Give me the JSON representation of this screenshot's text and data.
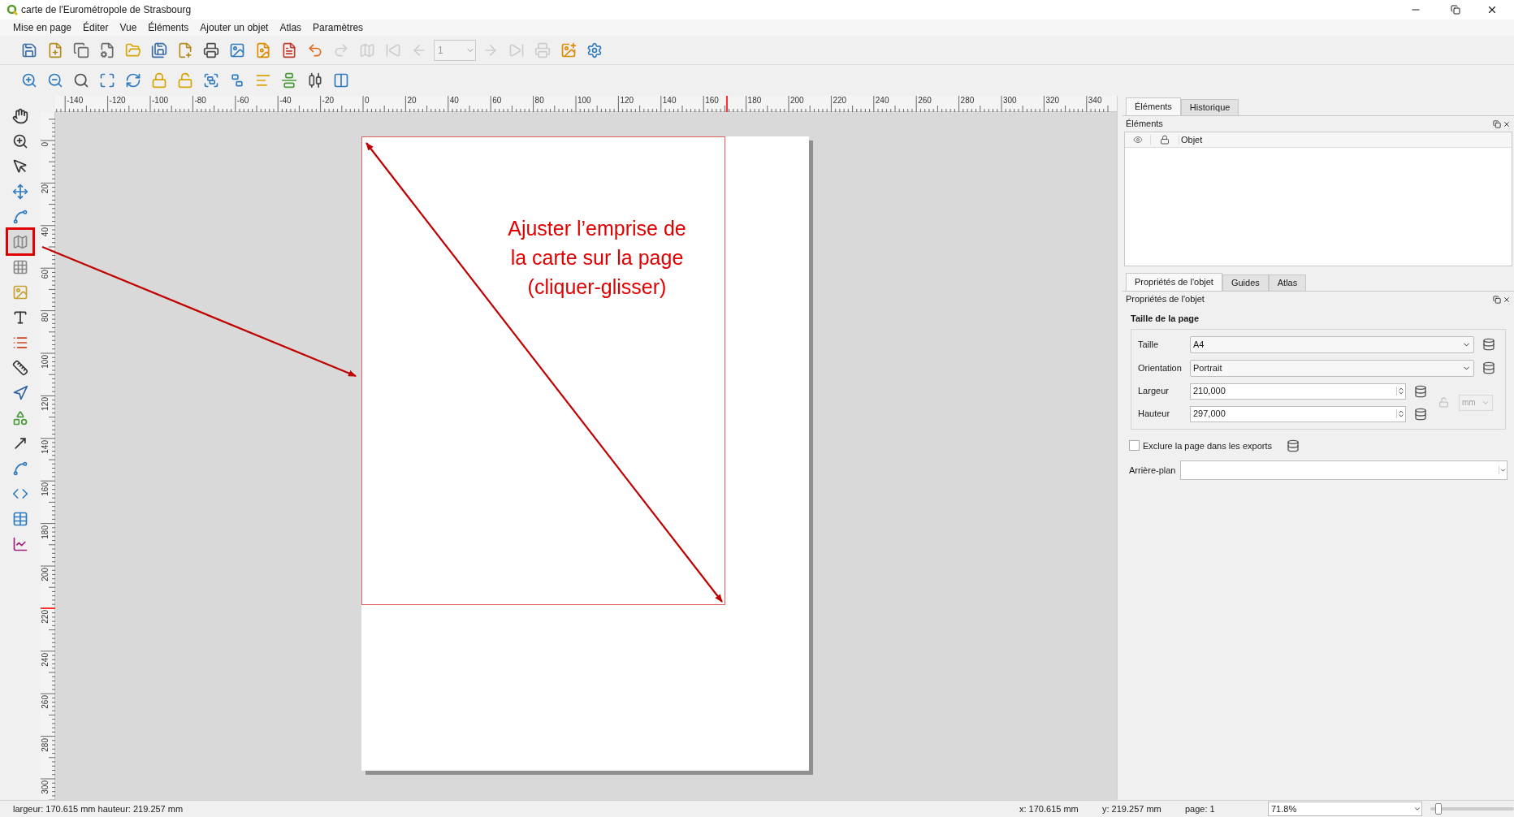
{
  "window": {
    "title": "carte de l'Eurométropole de Strasbourg"
  },
  "menu": [
    {
      "label": "Mise en page"
    },
    {
      "label": "Éditer"
    },
    {
      "label": "Vue"
    },
    {
      "label": "Éléments"
    },
    {
      "label": "Ajouter un objet"
    },
    {
      "label": "Atlas"
    },
    {
      "label": "Paramètres"
    }
  ],
  "toolbar": [
    {
      "kind": "button",
      "disabled": false
    },
    {
      "kind": "button",
      "disabled": false
    },
    {
      "kind": "button",
      "disabled": false
    },
    {
      "kind": "button",
      "disabled": false
    },
    {
      "kind": "button",
      "disabled": false
    },
    {
      "kind": "button",
      "disabled": false
    },
    {
      "kind": "button",
      "disabled": false
    },
    {
      "kind": "button",
      "disabled": false
    },
    {
      "kind": "button",
      "disabled": false
    },
    {
      "kind": "button",
      "disabled": false
    },
    {
      "kind": "button",
      "disabled": false
    },
    {
      "kind": "button",
      "disabled": false
    },
    {
      "kind": "button",
      "disabled": true
    },
    {
      "kind": "button",
      "disabled": true
    },
    {
      "kind": "button",
      "disabled": true
    },
    {
      "kind": "button",
      "disabled": true
    },
    {
      "kind": "field",
      "disabled": true,
      "value": "1"
    },
    {
      "kind": "button",
      "disabled": true
    },
    {
      "kind": "button",
      "disabled": true
    },
    {
      "kind": "button",
      "disabled": true
    },
    {
      "kind": "button",
      "disabled": false
    },
    {
      "kind": "button",
      "disabled": false
    }
  ],
  "ruler_h": [
    "-140",
    "-120",
    "-100",
    "-80",
    "-60",
    "-40",
    "-20",
    "0",
    "20",
    "40",
    "60",
    "80",
    "100",
    "120",
    "140",
    "160",
    "180",
    "200",
    "220",
    "240",
    "260",
    "280",
    "300",
    "320",
    "340"
  ],
  "ruler_v": [
    "0",
    "20",
    "40",
    "60",
    "80",
    "100",
    "120",
    "140",
    "160",
    "180",
    "200",
    "220",
    "240",
    "260",
    "280",
    "300"
  ],
  "tools": [
    {
      "selected": false
    },
    {
      "selected": false
    },
    {
      "selected": false
    },
    {
      "selected": false
    },
    {
      "selected": false
    },
    {
      "selected": true
    },
    {
      "selected": false
    },
    {
      "selected": false
    },
    {
      "selected": false
    },
    {
      "selected": false
    },
    {
      "selected": false
    },
    {
      "selected": false
    },
    {
      "selected": false
    },
    {
      "selected": false
    },
    {
      "selected": false
    },
    {
      "selected": false
    },
    {
      "selected": false
    },
    {
      "selected": false
    }
  ],
  "annotation": {
    "lines": [
      "Ajuster l’emprise de",
      "la carte sur la page",
      "(cliquer-glisser)"
    ]
  },
  "items_dock": {
    "tabs": [
      {
        "label": "Éléments",
        "selected": true
      },
      {
        "label": "Historique",
        "selected": false
      }
    ],
    "title": "Éléments",
    "column": "Objet"
  },
  "properties_dock": {
    "tabs": [
      {
        "label": "Propriétés de l'objet",
        "selected": true
      },
      {
        "label": "Guides",
        "selected": false
      },
      {
        "label": "Atlas",
        "selected": false
      }
    ],
    "title": "Propriétés de l'objet",
    "group": "Taille de la page",
    "fields": [
      {
        "kind": "combo",
        "label": "Taille",
        "value": "A4"
      },
      {
        "kind": "combo",
        "label": "Orientation",
        "value": "Portrait"
      },
      {
        "kind": "spin",
        "label": "Largeur",
        "value": "210,000"
      },
      {
        "kind": "spin",
        "label": "Hauteur",
        "value": "297,000"
      }
    ],
    "unit": {
      "value": "mm",
      "disabled": true
    },
    "exclude": {
      "label": "Exclure la page dans les exports",
      "checked": false
    },
    "background": {
      "label": "Arrière-plan"
    }
  },
  "status_bar": {
    "size": "largeur: 170.615 mm hauteur: 219.257 mm",
    "x": "x: 170.615 mm",
    "y": "y: 219.257 mm",
    "page": "page: 1",
    "zoom": "71.8%",
    "zoom_level": {
      "level": 0.1
    }
  }
}
